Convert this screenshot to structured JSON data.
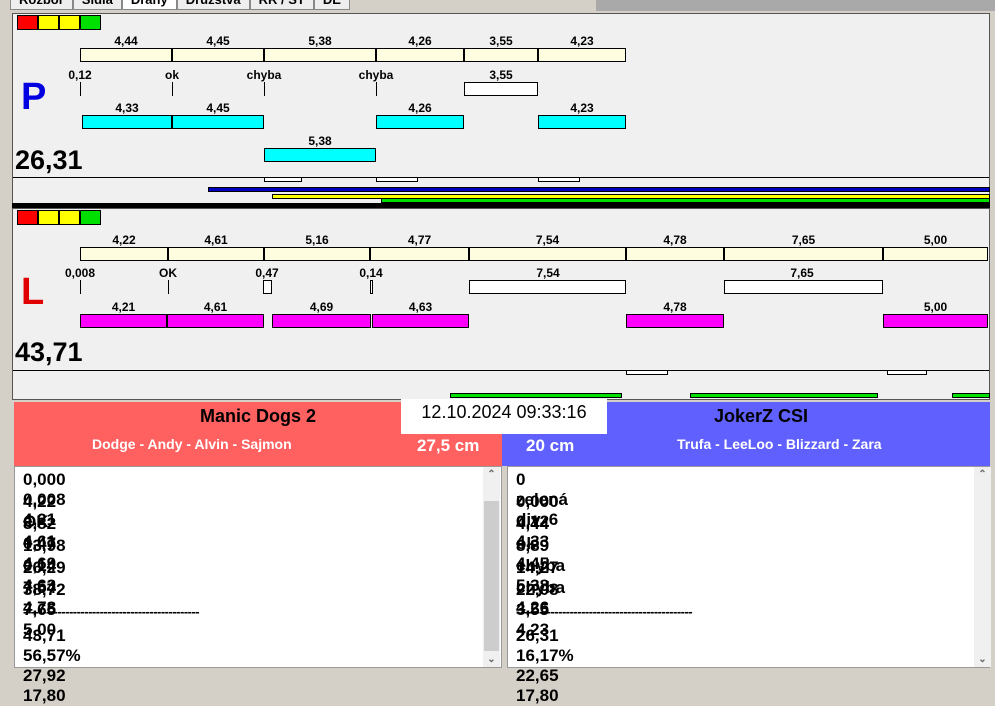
{
  "tabs": [
    "Rozbor",
    "Sidla",
    "Dráhy",
    "Družstva",
    "RR / ST",
    "DE"
  ],
  "colors": {
    "red": "#ff0000",
    "yellow": "#ffff00",
    "green": "#00e000",
    "cream": "#fffde0",
    "cyan": "#00ffff",
    "magenta": "#ff00ff",
    "blue_team": "#6060ff",
    "red_team": "#ff6060"
  },
  "top": {
    "letter": "P",
    "total": "26,31",
    "row1": [
      "4,44",
      "4,45",
      "5,38",
      "4,26",
      "3,55",
      "4,23"
    ],
    "row2": [
      "0,12",
      "ok",
      "chyba",
      "chyba",
      "3,55"
    ],
    "row3": [
      "4,33",
      "4,45",
      "4,26",
      "4,23"
    ],
    "row4": [
      "5,38"
    ]
  },
  "bottom": {
    "letter": "L",
    "total": "43,71",
    "row1": [
      "4,22",
      "4,61",
      "5,16",
      "4,77",
      "7,54",
      "4,78",
      "7,65",
      "5,00"
    ],
    "row2": [
      "0,008",
      "OK",
      "0,47",
      "0,14",
      "7,54",
      "7,65"
    ],
    "row3": [
      "4,21",
      "4,61",
      "4,69",
      "4,63",
      "4,78",
      "5,00"
    ]
  },
  "datetime": "12.10.2024 09:33:16",
  "left_team": {
    "name": "Manic Dogs 2",
    "dogs": "Dodge - Andy - Alvin - Sajmon",
    "height": "27,5 cm",
    "rows": [
      [
        "0,000",
        "0,008",
        "4,21",
        ""
      ],
      [
        "4,22",
        "OK",
        "4,61",
        ""
      ],
      [
        "8,82",
        "0,47",
        "4,69",
        ""
      ],
      [
        "13,98",
        "0,14",
        "4,63",
        ""
      ],
      [
        "26,29",
        "7,54",
        "4,78",
        ""
      ],
      [
        "38,72",
        "7,65",
        "5,00",
        ""
      ]
    ],
    "separator": "----------------------------------------------",
    "summary": [
      "43,71",
      "56,57%",
      "27,92",
      "17,80"
    ]
  },
  "right_team": {
    "name": "JokerZ CSI",
    "dogs": "Trufa - LeeLoo - Blizzard - Zara",
    "height": "20 cm",
    "header": [
      "0",
      "zelená",
      "div. 6"
    ],
    "rows": [
      [
        "0,000",
        "0,12",
        "4,33"
      ],
      [
        "4,44",
        "ok",
        "4,45"
      ],
      [
        "8,89",
        "chyba",
        "5,38"
      ],
      [
        "14,27",
        "chyba",
        "4,26"
      ],
      [
        "22,08",
        "3,55",
        "4,23"
      ]
    ],
    "separator": "----------------------------------------------",
    "summary": [
      "26,31",
      "16,17%",
      "22,65",
      "17,80"
    ]
  }
}
